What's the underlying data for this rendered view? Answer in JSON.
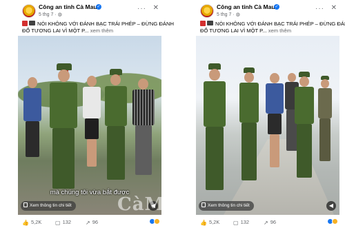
{
  "posts": [
    {
      "page_name": "Công an tỉnh Cà Mau",
      "verified_icon": "verified-badge-icon",
      "time": "5 thg 7 · ",
      "privacy_icon": "globe-icon",
      "more_label": "···",
      "close_label": "✕",
      "caption": "NÓI KHÔNG VỚI ĐÁNH BẠC TRÁI PHÉP – ĐỪNG ĐÁNH ĐỔ TƯƠNG LAI VÌ MỘT P...",
      "see_more": "xem thêm",
      "video_subtitle": "mà chúng tôi vừa bắt được",
      "details_label": "Xem thông tin chi tiết",
      "mute_label": "◀",
      "reaction_count": "5,2K",
      "comment_count": "132",
      "share_count": "96"
    },
    {
      "page_name": "Công an tỉnh Cà Mau",
      "verified_icon": "verified-badge-icon",
      "time": "5 thg 7 · ",
      "privacy_icon": "globe-icon",
      "more_label": "···",
      "close_label": "✕",
      "caption": "NÓI KHÔNG VỚI ĐÁNH BẠC TRÁI PHÉP – ĐỪNG ĐÁNH ĐỔ TƯƠNG LAI VÌ MỘT P...",
      "see_more": "xem thêm",
      "video_subtitle": "",
      "details_label": "Xem thông tin chi tiết",
      "mute_label": "◀",
      "reaction_count": "5,2K",
      "comment_count": "132",
      "share_count": "96"
    }
  ],
  "watermark": "CàMau",
  "colors": {
    "facebook_blue": "#1877f2",
    "uniform_green": "#3f5a2a",
    "muted_text": "#65676b"
  }
}
